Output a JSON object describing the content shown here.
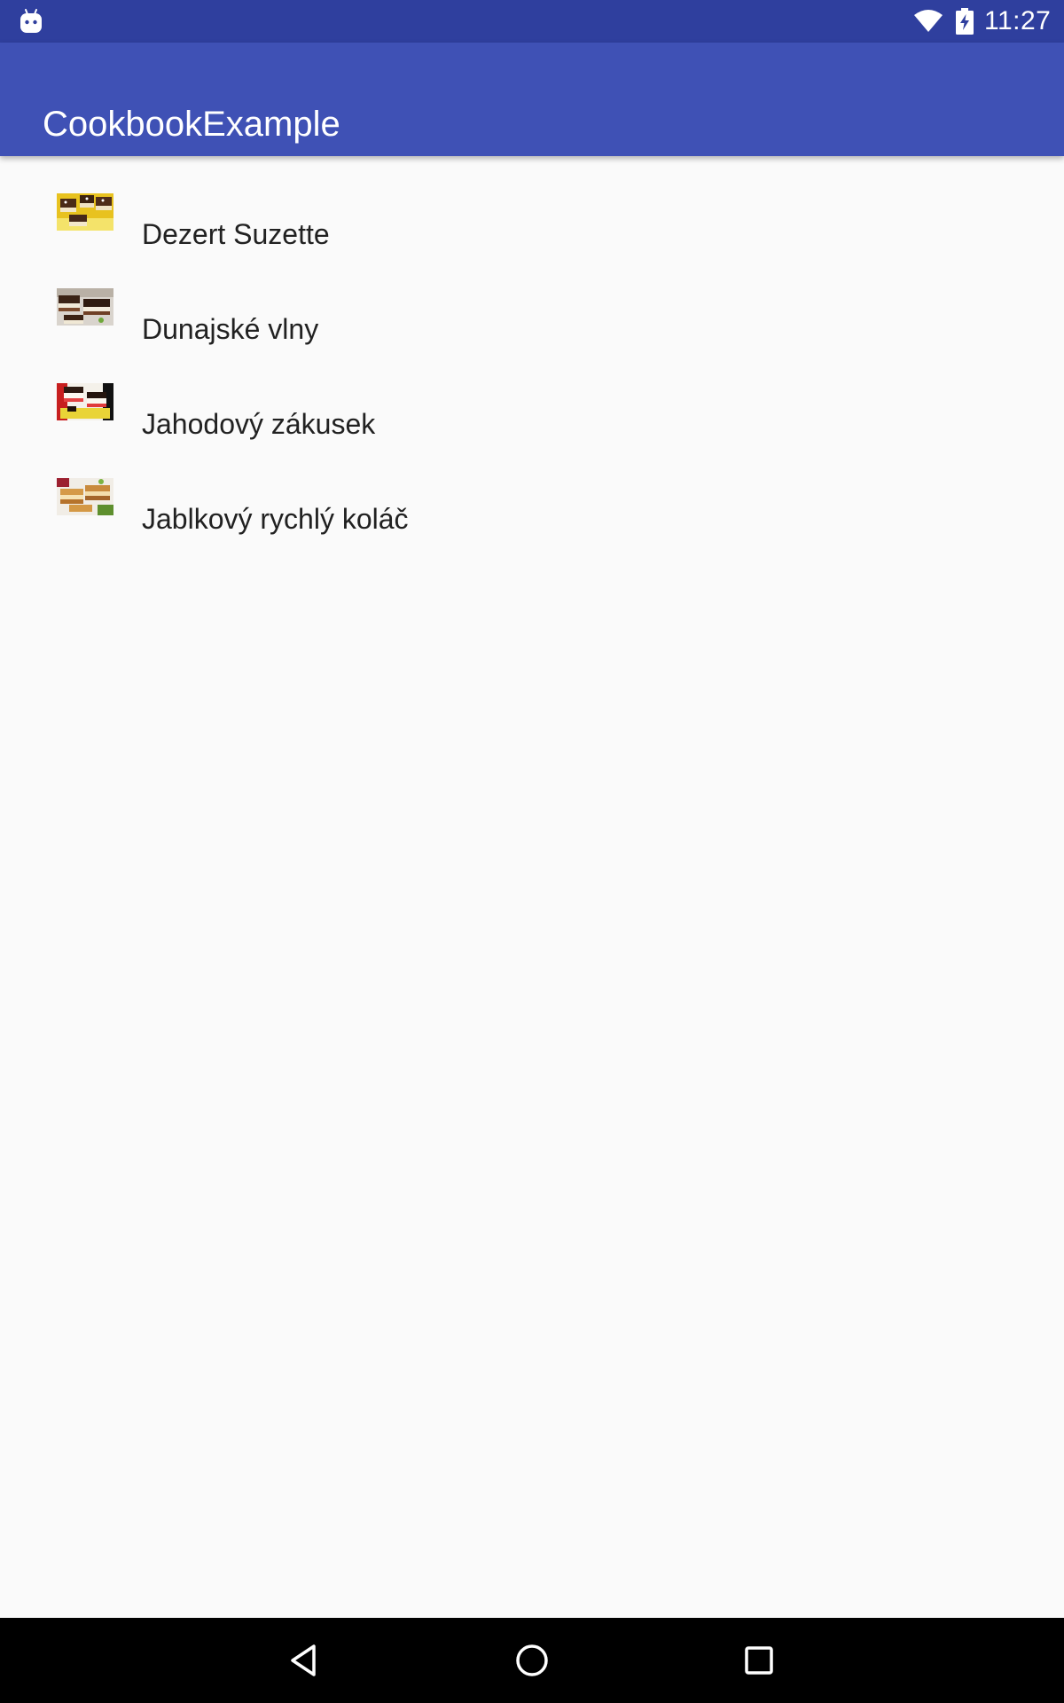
{
  "status_bar": {
    "time": "11:27",
    "icons": [
      "android-icon",
      "wifi-icon",
      "battery-charging-icon"
    ]
  },
  "app_bar": {
    "title": "CookbookExample",
    "color": "#3f51b5",
    "status_color": "#2f3f9e"
  },
  "recipes": [
    {
      "name": "Dezert Suzette",
      "thumbnail": "dessert-thumbnail-image"
    },
    {
      "name": "Dunajské vlny",
      "thumbnail": "dessert-thumbnail-image"
    },
    {
      "name": "Jahodový zákusek",
      "thumbnail": "dessert-thumbnail-image"
    },
    {
      "name": "Jablkový rychlý koláč",
      "thumbnail": "dessert-thumbnail-image"
    }
  ],
  "nav_bar": {
    "buttons": [
      "back-icon",
      "home-icon",
      "recents-icon"
    ]
  }
}
